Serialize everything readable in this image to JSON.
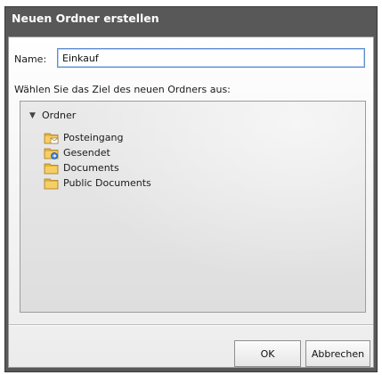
{
  "dialog": {
    "title": "Neuen Ordner erstellen",
    "name_label": "Name:",
    "name_value": "Einkauf",
    "select_label": "Wählen Sie das Ziel des neuen Ordners aus:",
    "tree": {
      "root_arrow": "▼",
      "root_label": "Ordner",
      "items": [
        {
          "label": "Posteingang",
          "icon": "inbox-folder-icon"
        },
        {
          "label": "Gesendet",
          "icon": "sent-folder-icon"
        },
        {
          "label": "Documents",
          "icon": "folder-icon"
        },
        {
          "label": "Public Documents",
          "icon": "folder-icon"
        }
      ]
    },
    "ok_label": "OK",
    "cancel_label": "Abbrechen"
  }
}
